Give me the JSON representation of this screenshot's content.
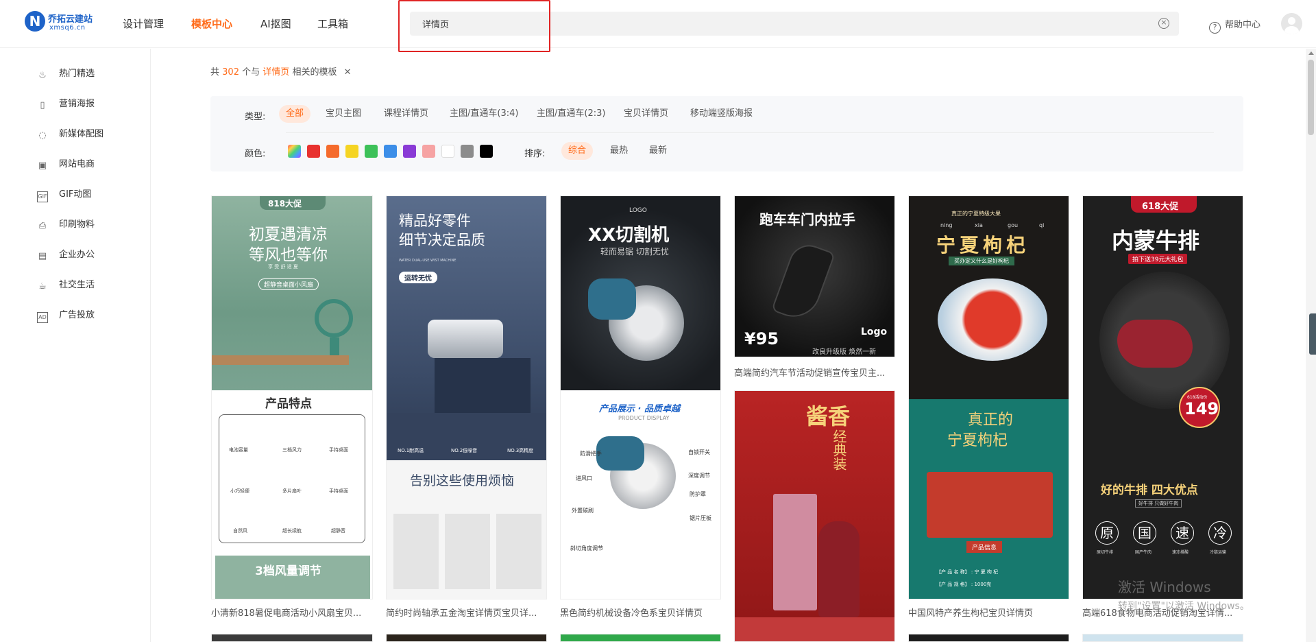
{
  "brand": {
    "logo_mark": "N",
    "title": "乔拓云建站",
    "subtitle": "xmsq6.cn"
  },
  "nav": [
    {
      "label": "设计管理",
      "active": false
    },
    {
      "label": "模板中心",
      "active": true
    },
    {
      "label": "AI抠图",
      "active": false
    },
    {
      "label": "工具箱",
      "active": false
    }
  ],
  "search": {
    "value": "详情页",
    "placeholder": ""
  },
  "header": {
    "help_label": "帮助中心"
  },
  "sidebar": {
    "items": [
      {
        "label": "热门精选",
        "icon": "flame-icon"
      },
      {
        "label": "营销海报",
        "icon": "poster-icon"
      },
      {
        "label": "新媒体配图",
        "icon": "chat-icon"
      },
      {
        "label": "网站电商",
        "icon": "shop-icon"
      },
      {
        "label": "GIF动图",
        "icon": "gif-icon"
      },
      {
        "label": "印刷物料",
        "icon": "print-icon"
      },
      {
        "label": "企业办公",
        "icon": "briefcase-icon"
      },
      {
        "label": "社交生活",
        "icon": "cup-icon"
      },
      {
        "label": "广告投放",
        "icon": "ad-icon"
      }
    ]
  },
  "results": {
    "prefix": "共",
    "count": "302",
    "mid": "个与",
    "keyword": "详情页",
    "suffix": "相关的模板"
  },
  "filters": {
    "type_label": "类型:",
    "types": [
      "全部",
      "宝贝主图",
      "课程详情页",
      "主图/直通车(3:4)",
      "主图/直通车(2:3)",
      "宝贝详情页",
      "移动端竖版海报"
    ],
    "active_type": "全部",
    "color_label": "颜色:",
    "colors": [
      "gradient",
      "#e8322f",
      "#f56b2c",
      "#f5d423",
      "#3dc159",
      "#3c8ee8",
      "#8a3bd6",
      "#f6a3a3",
      "#ffffff",
      "#8c8c8c",
      "#000000"
    ],
    "sort_label": "排序:",
    "sorts": [
      "综合",
      "最热",
      "最新"
    ],
    "active_sort": "综合"
  },
  "templates": [
    {
      "caption": "小清新818暑促电商活动小风扇宝贝..."
    },
    {
      "caption": "简约时尚轴承五金淘宝详情页宝贝详..."
    },
    {
      "caption": "黑色简约机械设备冷色系宝贝详情页"
    },
    {
      "caption": "高端简约汽车节活动促销宣传宝贝主..."
    },
    {
      "caption": "中国风特产养生枸杞宝贝详情页"
    },
    {
      "caption": "高端618食物电商活动促销淘宝详情..."
    }
  ],
  "poster_text": {
    "fan": {
      "badge": "818大促",
      "h1": "初夏遇清凉",
      "h2": "等风也等你",
      "small": "享 受 舒 适 夏",
      "pill": "超静音桌面小风扇",
      "features_title": "产品特点",
      "features": [
        "电池容量",
        "三档风力",
        "手持桌面",
        "小巧轻便",
        "多片扇叶",
        "手持桌面",
        "自然风",
        "超长续航",
        "超静音"
      ],
      "footer": "3档风量调节"
    },
    "valve": {
      "h1": "精品好零件",
      "h2": "细节决定品质",
      "small": "WATER DUAL-USE WIST MACHINE",
      "pill": "运转无忧",
      "stats": [
        "NO.1耐高温",
        "NO.2低噪音",
        "NO.3高精度"
      ],
      "h3": "告别这些使用烦恼"
    },
    "saw": {
      "logo": "LOGO",
      "h1": "XX切割机",
      "h2": "轻而易锯  切割无忧",
      "h3": "产品展示 · 品质卓越",
      "small": "PRODUCT DISPLAY",
      "labels_left": [
        "防滑把手",
        "进风口",
        "外置碳刷",
        "斜切角度调节"
      ],
      "labels_right": [
        "自锁开关",
        "深度调节",
        "防护罩",
        "锯片压板"
      ]
    },
    "car": {
      "h1": "跑车车门内拉手",
      "price": "¥95",
      "note": "改良升级版  焕然一新",
      "logo": "Logo"
    },
    "liquor": {
      "h1": "酱香",
      "h2": "经典装"
    },
    "goji": {
      "top": "真正的宁夏特级大果",
      "pinyin": [
        "ning",
        "xia",
        "gou",
        "qi"
      ],
      "h1": "宁夏枸杞",
      "sub": "买办定义什么是好枸杞",
      "h2": "真正的",
      "h3": "宁夏枸杞",
      "tag": "产品信息",
      "info1": "【产 品 名 称】 :       宁 夏 枸 杞",
      "info2": "【产 品 规 格】 :        1000克"
    },
    "steak": {
      "badge": "618大促",
      "h1": "内蒙牛排",
      "pill": "拍下送39元大礼包",
      "price_tag": "618活动价",
      "price": "149",
      "h2": "好的牛排 四大优点",
      "small": "好牛排 只做好牛肉",
      "chars": [
        "原",
        "国",
        "速",
        "冷"
      ],
      "char_labels": [
        "原切牛排",
        "国产牛肉",
        "速冻排酸",
        "冷链运输"
      ]
    }
  },
  "watermark": {
    "line1": "激活 Windows",
    "line2": "转到\"设置\"以激活 Windows。"
  }
}
